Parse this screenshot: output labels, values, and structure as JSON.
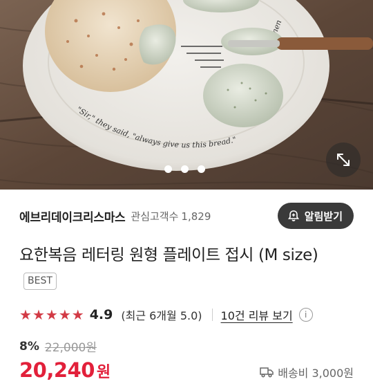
{
  "hero": {
    "plate_text_left": "\"Sir,\" they said, \"always give us this bread.\"",
    "plate_text_right": "Amen",
    "slide_count": 3,
    "active_slide": 1
  },
  "seller": {
    "name": "에브리데이크리스마스",
    "followers_label": "관심고객수",
    "followers_count": "1,829",
    "alarm_button": "알림받기"
  },
  "product": {
    "title": "요한복음 레터링 원형 플레이트 접시 (M size)",
    "badge": "BEST"
  },
  "rating": {
    "stars": 5,
    "score": "4.9",
    "recent": "(최근 6개월 5.0)",
    "review_link": "10건 리뷰 보기",
    "info": "i"
  },
  "pricing": {
    "discount": "8%",
    "original_price": "22,000원",
    "price": "20,240",
    "price_unit": "원",
    "shipping": "배송비 3,000원"
  },
  "colors": {
    "accent_red": "#e2203a",
    "star_red": "#d23a45"
  }
}
